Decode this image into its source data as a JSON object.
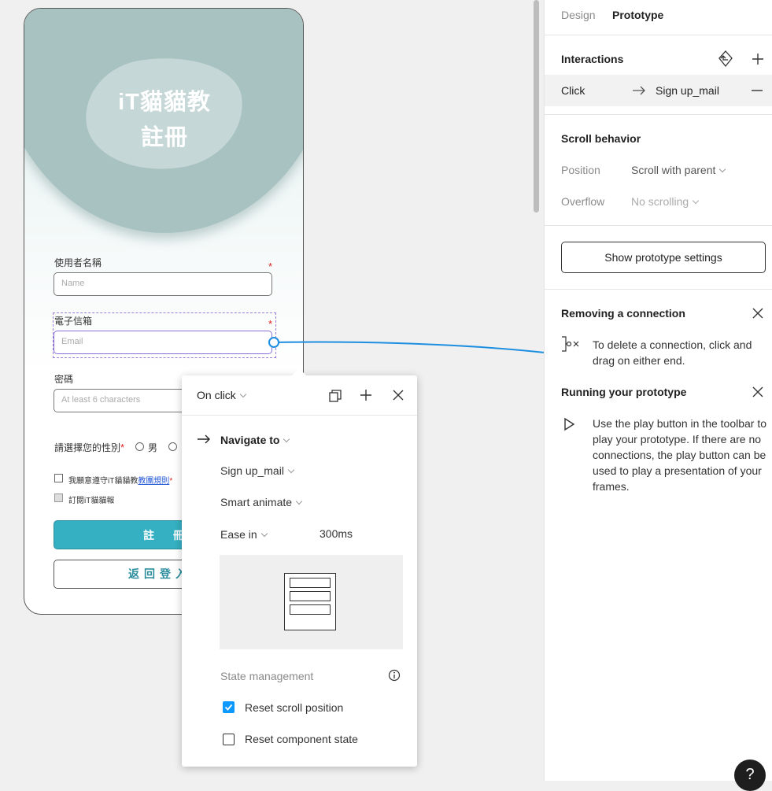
{
  "canvas": {
    "hero_title_line1": "iT貓貓教",
    "hero_title_line2": "註冊",
    "username_label": "使用者名稱",
    "username_placeholder": "Name",
    "email_label": "電子信箱",
    "email_placeholder": "Email",
    "password_label": "密碼",
    "password_placeholder": "At least 6 characters",
    "required_mark": "*",
    "gender_label": "請選擇您的性別",
    "gender_male": "男",
    "agree_prefix": "我願意遵守iT貓貓教",
    "agree_link": "教團規則",
    "subscribe_label": "訂閱iT貓貓報",
    "register_button": "註 冊",
    "back_button": "返回登入頁"
  },
  "panel": {
    "tabs": [
      "Design",
      "Prototype"
    ],
    "active_tab": "Prototype",
    "interactions_title": "Interactions",
    "interaction_trigger": "Click",
    "interaction_target": "Sign up_mail",
    "scroll_behavior_title": "Scroll behavior",
    "position_label": "Position",
    "position_value": "Scroll with parent",
    "overflow_label": "Overflow",
    "overflow_value": "No scrolling",
    "show_settings_button": "Show prototype settings",
    "removing_title": "Removing a connection",
    "removing_text": "To delete a connection, click and drag on either end.",
    "running_title": "Running your prototype",
    "running_text": "Use the play button in the toolbar to play your prototype. If there are no connections, the play button can be used to play a presentation of your frames.",
    "help_label": "?"
  },
  "popup": {
    "trigger": "On click",
    "action": "Navigate to",
    "destination": "Sign up_mail",
    "animation": "Smart animate",
    "easing": "Ease in",
    "duration": "300ms",
    "state_title": "State management",
    "reset_scroll_label": "Reset scroll position",
    "reset_scroll_checked": true,
    "reset_component_label": "Reset component state",
    "reset_component_checked": false
  },
  "colors": {
    "accent": "#0d99ff",
    "connector": "#1e8fe0",
    "register_button": "#35b0c2"
  }
}
